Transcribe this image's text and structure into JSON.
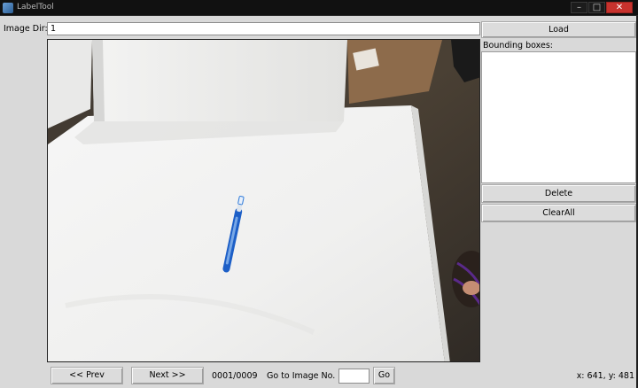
{
  "window": {
    "title": "LabelTool",
    "minimize_glyph": "–",
    "maximize_glyph": "□",
    "close_glyph": "✕"
  },
  "toolbar": {
    "dir_label": "Image Dir:",
    "dir_value": "1",
    "load_label": "Load"
  },
  "panel": {
    "bbox_label": "Bounding boxes:",
    "bbox_items": [],
    "delete_label": "Delete",
    "clear_label": "ClearAll"
  },
  "canvas": {
    "content": "photo of a blue toothbrush lying on a white board"
  },
  "nav": {
    "prev_label": "<< Prev",
    "next_label": "Next >>",
    "progress": "0001/0009",
    "goto_label": "Go to Image No.",
    "goto_value": "",
    "go_label": "Go",
    "coords": "x: 641, y: 481"
  },
  "colors": {
    "client_bg": "#d9d9d9",
    "titlebar_bg": "#111111",
    "close_bg": "#c7322d"
  },
  "icons": {
    "app": "app-icon",
    "min": "minimize-icon",
    "max": "maximize-icon",
    "close": "close-icon"
  }
}
